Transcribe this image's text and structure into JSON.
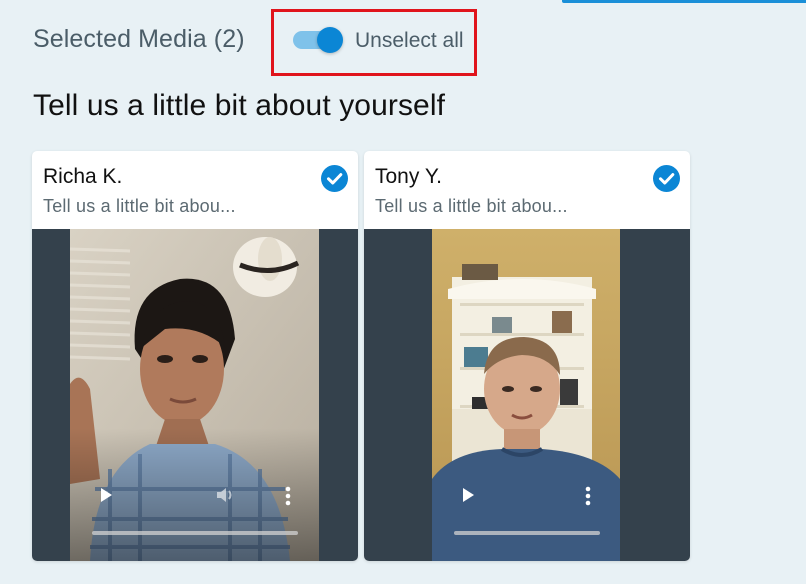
{
  "header": {
    "selected_media_label": "Selected Media (2)",
    "toggle_on": true,
    "unselect_all_label": "Unselect all"
  },
  "question": {
    "title": "Tell us a little bit about yourself"
  },
  "colors": {
    "accent": "#0b86d5",
    "toggle_track": "#7fc2ea",
    "highlight_border": "#e0141c",
    "page_background": "#e8f1f5",
    "video_background": "#34414c"
  },
  "cards": [
    {
      "name": "Richa K.",
      "subtitle": "Tell us a little bit abou...",
      "selected": true,
      "icons": [
        "check-icon",
        "play-icon",
        "volume-icon",
        "more-vertical-icon"
      ]
    },
    {
      "name": "Tony Y.",
      "subtitle": "Tell us a little bit abou...",
      "selected": true,
      "icons": [
        "check-icon",
        "play-icon",
        "more-vertical-icon"
      ]
    }
  ]
}
